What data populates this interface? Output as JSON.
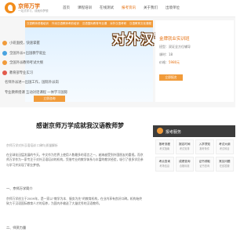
{
  "header": {
    "logo_name": "京师万学",
    "logo_sub": "一站式学习，成就你梦想",
    "nav": [
      {
        "label": "首页",
        "active": false
      },
      {
        "label": "课程培训",
        "active": false
      },
      {
        "label": "在线测试",
        "active": false
      },
      {
        "label": "报考资讯",
        "active": true
      },
      {
        "label": "关于我们",
        "active": false
      },
      {
        "label": "出境单位",
        "active": false
      }
    ]
  },
  "hero": {
    "categories": [
      "汉语教师资格培训",
      "外派汉语教师考前培训",
      "汉语国际教育专业课",
      "对外汉语考研",
      "汉语教育文化课程"
    ],
    "banner_text": "对外汉语",
    "left_menu": [
      {
        "label": "小班面授，快速掌握",
        "color": "#f19b3a"
      },
      {
        "label": "全国外派+出国教学就业",
        "color": "#49a3e0"
      },
      {
        "label": "全国外派教师考试大纲",
        "color": "#f19b3a"
      },
      {
        "label": "教育部专业实习",
        "color": "#e25a4b"
      },
      {
        "label": "名师外派进一出国工作，国际外派岗",
        "color": "#49a3e0"
      },
      {
        "label": "专业教师授课 互动对话课程 一体学习国际",
        "color": "#f19b3a"
      }
    ],
    "left_button": "立即咨询",
    "course_title": "金牌就业实训班",
    "info_lines": [
      {
        "label": "班型：",
        "value": "双证全方位辅导"
      },
      {
        "label": "课时：",
        "value": "18"
      },
      {
        "label": "价格：",
        "value": "5980元"
      }
    ],
    "side_button": "立即报名"
  },
  "article": {
    "title": "感谢京师万学成就我汉语教师梦",
    "meta": "京师万学对外汉语培训   口碑与质量解析",
    "paragraphs": [
      "在全球化迅猛发展的今天，中文作为世界上使用人数最多的语言之一，越来越受到外国朋友的重视。而京师万学作为一家专注于对外汉语培训的机构，凭借专业的教学体系与丰富的教学经验，吸引了很多学员参与学习并实现了职业梦想。",
      "京师万学创立于2009年，是一家以“教学为本、服务为先”的教育机构，在业内享有良好口碑。机构始终致力于汉语国际教育人才的培养，为国内外输送了大量优秀的汉语教师。"
    ],
    "headings": [
      "一、京师万学简介",
      "二、师资力量"
    ]
  },
  "right_panel": {
    "title": "报考服务",
    "cells": [
      {
        "name": "报考流程",
        "sub": "考试指南"
      },
      {
        "name": "报名时间",
        "sub": "考试安排"
      },
      {
        "name": "入学须知",
        "sub": "报考条件"
      },
      {
        "name": "考试大纲",
        "sub": "考试科目"
      },
      {
        "name": "考点查询",
        "sub": "考场信息"
      },
      {
        "name": "成绩查询",
        "sub": "合格标准"
      },
      {
        "name": "证书领取",
        "sub": "证书查询"
      },
      {
        "name": "常见问题",
        "sub": "在线答疑"
      }
    ]
  }
}
